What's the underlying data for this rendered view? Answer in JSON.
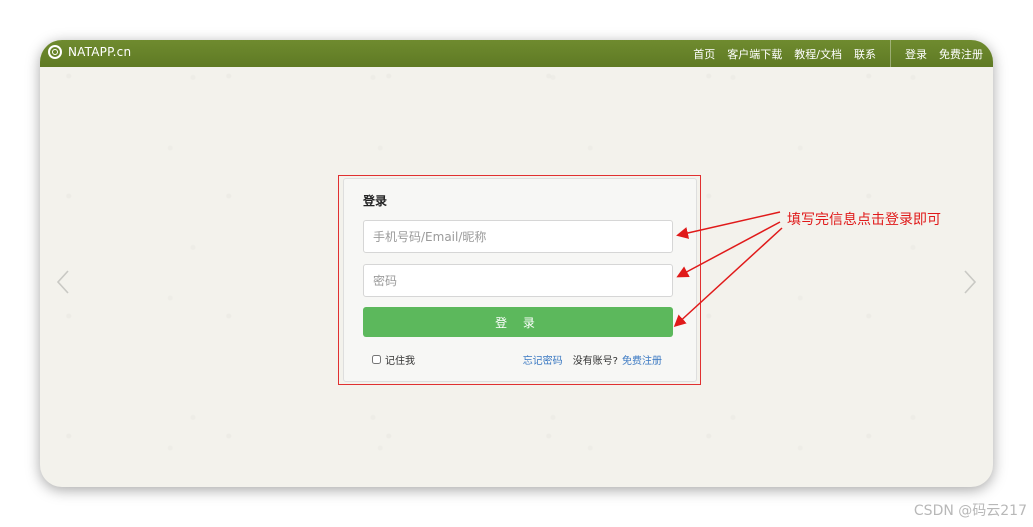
{
  "navbar": {
    "brand": "NATAPP.cn",
    "links": [
      "首页",
      "客户端下载",
      "教程/文档",
      "联系"
    ],
    "login": "登录",
    "register": "免费注册"
  },
  "login_form": {
    "title": "登录",
    "username_placeholder": "手机号码/Email/昵称",
    "password_placeholder": "密码",
    "submit_label": "登 录",
    "remember_label": "记住我",
    "forgot_label": "忘记密码",
    "no_account_label": "没有账号?",
    "register_label": "免费注册"
  },
  "annotation": {
    "text": "填写完信息点击登录即可",
    "color": "#e01a1a"
  },
  "watermark": "CSDN @码云217",
  "colors": {
    "navbar": "#6f8b2f",
    "button": "#5cb85c",
    "link": "#3a78c2",
    "highlight": "#e03030"
  }
}
